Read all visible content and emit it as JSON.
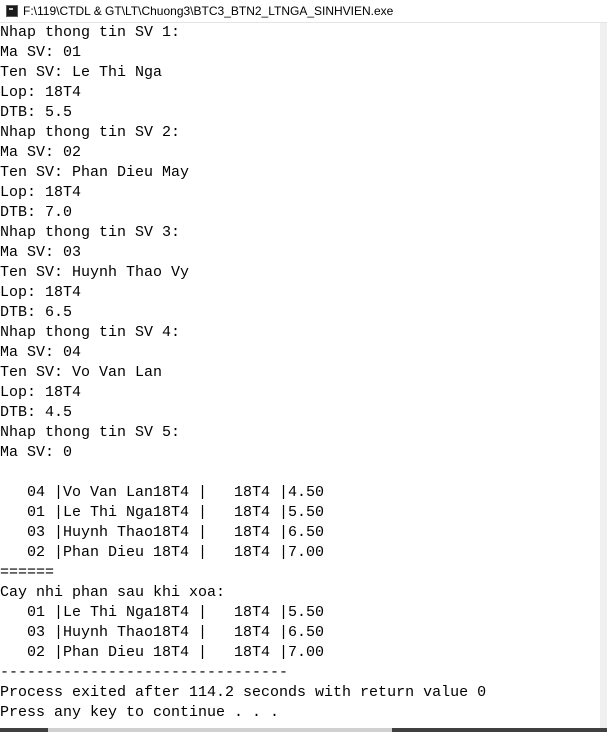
{
  "window": {
    "title": "F:\\119\\CTDL & GT\\LT\\Chuong3\\BTC3_BTN2_LTNGA_SINHVIEN.exe"
  },
  "console": {
    "lines": [
      "Nhap thong tin SV 1:",
      "Ma SV: 01",
      "Ten SV: Le Thi Nga",
      "Lop: 18T4",
      "DTB: 5.5",
      "Nhap thong tin SV 2:",
      "Ma SV: 02",
      "Ten SV: Phan Dieu May",
      "Lop: 18T4",
      "DTB: 7.0",
      "Nhap thong tin SV 3:",
      "Ma SV: 03",
      "Ten SV: Huynh Thao Vy",
      "Lop: 18T4",
      "DTB: 6.5",
      "Nhap thong tin SV 4:",
      "Ma SV: 04",
      "Ten SV: Vo Van Lan",
      "Lop: 18T4",
      "DTB: 4.5",
      "Nhap thong tin SV 5:",
      "Ma SV: 0",
      "",
      "   04 |Vo Van Lan18T4 |   18T4 |4.50",
      "   01 |Le Thi Nga18T4 |   18T4 |5.50",
      "   03 |Huynh Thao18T4 |   18T4 |6.50",
      "   02 |Phan Dieu 18T4 |   18T4 |7.00",
      "======",
      "Cay nhi phan sau khi xoa:",
      "   01 |Le Thi Nga18T4 |   18T4 |5.50",
      "   03 |Huynh Thao18T4 |   18T4 |6.50",
      "   02 |Phan Dieu 18T4 |   18T4 |7.00",
      "--------------------------------",
      "Process exited after 114.2 seconds with return value 0",
      "Press any key to continue . . ."
    ]
  }
}
